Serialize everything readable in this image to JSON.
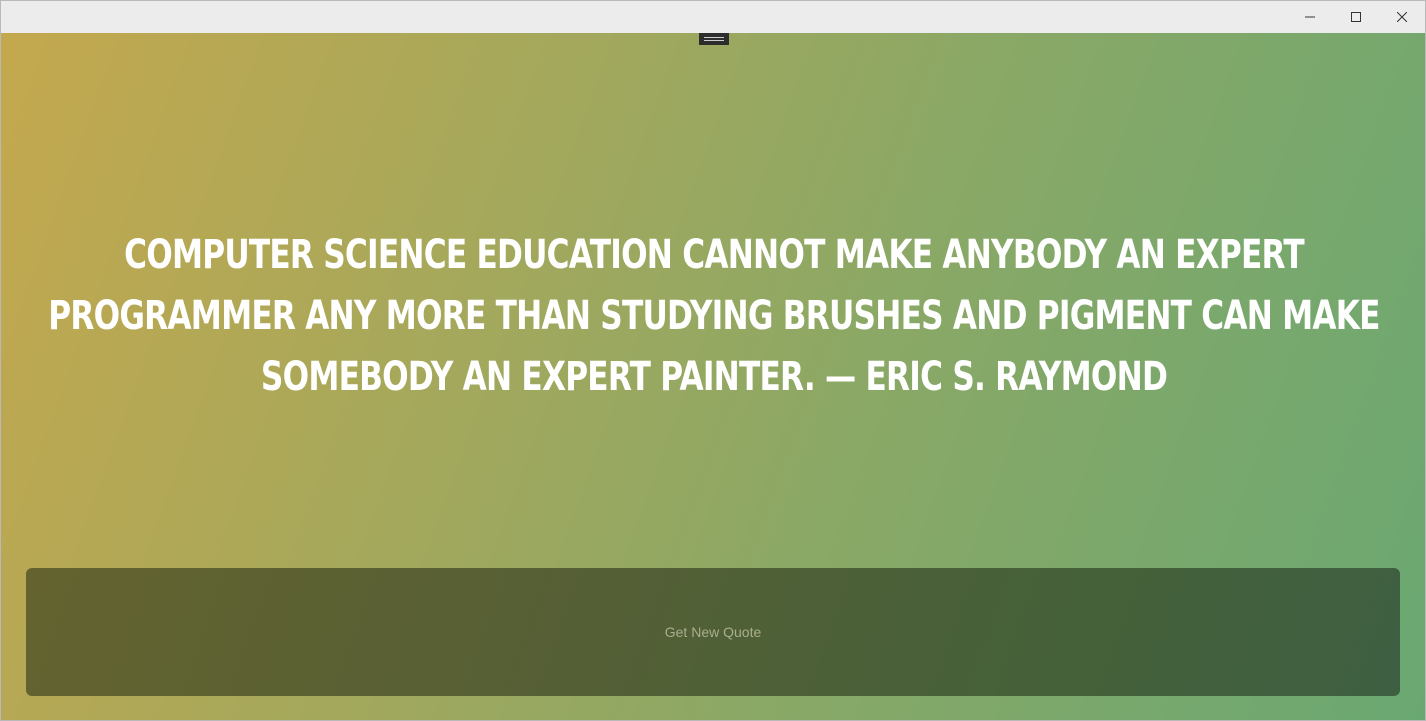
{
  "window": {
    "caption_buttons": [
      {
        "name": "minimize",
        "icon": "minimize-icon"
      },
      {
        "name": "maximize",
        "icon": "maximize-icon"
      },
      {
        "name": "close",
        "icon": "close-icon"
      }
    ]
  },
  "quote": {
    "text": "Computer science education cannot make anybody an expert programmer any more than studying brushes and pigment can make somebody an expert painter. — Eric S. Raymond"
  },
  "actions": {
    "new_quote_label": "Get New Quote"
  },
  "colors": {
    "gradient_start": "#c4a84e",
    "gradient_end": "#6aa872",
    "button_start": "#64632f",
    "button_end": "#3e5f42",
    "quote_text": "#ffffff"
  }
}
